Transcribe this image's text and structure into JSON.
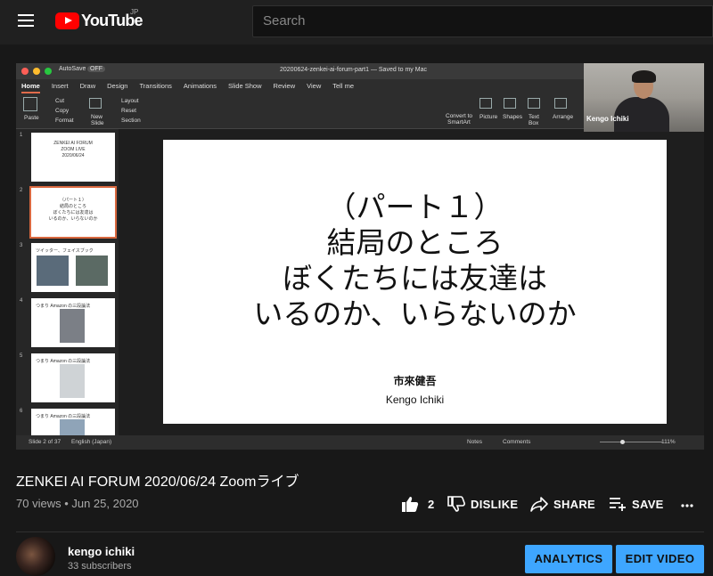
{
  "header": {
    "logo_text": "YouTube",
    "region": "JP",
    "search_placeholder": "Search"
  },
  "slideshow": {
    "autosave": "AutoSave",
    "toggle": "OFF",
    "doc_title": "20200624-zenkei-ai-forum-part1 — Saved to my Mac",
    "menu": [
      "Home",
      "Insert",
      "Draw",
      "Design",
      "Transitions",
      "Animations",
      "Slide Show",
      "Review",
      "View",
      "Tell me"
    ],
    "ribbon": {
      "paste": "Paste",
      "cut": "Cut",
      "copy": "Copy",
      "format": "Format",
      "new_slide": "New Slide",
      "layout": "Layout",
      "reset": "Reset",
      "section": "Section",
      "convert": "Convert to SmartArt",
      "picture": "Picture",
      "shapes": "Shapes",
      "textbox": "Text Box",
      "arrange": "Arrange"
    },
    "thumbs": [
      {
        "n": "1",
        "lines": [
          "ZENKEI AI FORUM",
          "ZOOM LIVE",
          "2020/06/24"
        ]
      },
      {
        "n": "2",
        "lines": [
          "（パート１）",
          "結局のところ",
          "ぼくたちには友達は",
          "いるのか、いらないのか"
        ]
      },
      {
        "n": "3",
        "lines": [
          "ツイッター、フェイスブック"
        ]
      },
      {
        "n": "4",
        "lines": [
          "つまり Amazon の三段論法"
        ]
      },
      {
        "n": "5",
        "lines": [
          "つまり Amazon の三段論法"
        ]
      },
      {
        "n": "6",
        "lines": [
          "つまり Amazon の三段論法"
        ]
      }
    ],
    "slide": {
      "line1": "（パート１）",
      "line2": "結局のところ",
      "line3": "ぼくたちには友達は",
      "line4": "いるのか、いらないのか",
      "author_jp": "市來健吾",
      "author_en": "Kengo Ichiki"
    },
    "status": {
      "slide_of": "Slide 2 of 37",
      "lang": "English (Japan)",
      "notes": "Notes",
      "comments": "Comments",
      "zoom_pct": "111%"
    },
    "watermark": "zoom",
    "camera_name": "Kengo Ichiki"
  },
  "video": {
    "title": "ZENKEI AI FORUM 2020/06/24 Zoomライブ",
    "meta": "70 views • Jun 25, 2020",
    "likes": "2",
    "dislike": "DISLIKE",
    "share": "SHARE",
    "save": "SAVE"
  },
  "channel": {
    "name": "kengo ichiki",
    "subscribers": "33 subscribers"
  },
  "buttons": {
    "analytics": "ANALYTICS",
    "edit": "EDIT VIDEO"
  }
}
